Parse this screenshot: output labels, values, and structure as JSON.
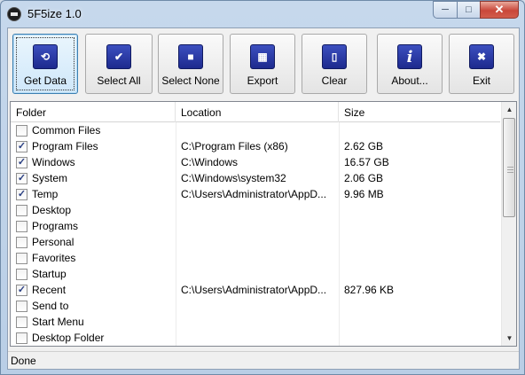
{
  "window": {
    "title": "5F5ize 1.0"
  },
  "toolbar": {
    "buttons": [
      {
        "label": "Get Data",
        "icon": "get-data-icon",
        "glyph": "⟲"
      },
      {
        "label": "Select All",
        "icon": "checkmark-icon",
        "glyph": "✔"
      },
      {
        "label": "Select None",
        "icon": "square-icon",
        "glyph": "■"
      },
      {
        "label": "Export",
        "icon": "export-icon",
        "glyph": "▦"
      },
      {
        "label": "Clear",
        "icon": "page-icon",
        "glyph": "▯"
      },
      {
        "label": "About...",
        "icon": "info-icon",
        "glyph": "i"
      },
      {
        "label": "Exit",
        "icon": "close-x-icon",
        "glyph": "✖"
      }
    ]
  },
  "list": {
    "columns": [
      "Folder",
      "Location",
      "Size"
    ],
    "rows": [
      {
        "checked": false,
        "folder": "Common Files",
        "location": "",
        "size": ""
      },
      {
        "checked": true,
        "folder": "Program Files",
        "location": "C:\\Program Files (x86)",
        "size": "2.62 GB"
      },
      {
        "checked": true,
        "folder": "Windows",
        "location": "C:\\Windows",
        "size": "16.57 GB"
      },
      {
        "checked": true,
        "folder": "System",
        "location": "C:\\Windows\\system32",
        "size": "2.06 GB"
      },
      {
        "checked": true,
        "folder": "Temp",
        "location": "C:\\Users\\Administrator\\AppD...",
        "size": "9.96 MB"
      },
      {
        "checked": false,
        "folder": "Desktop",
        "location": "",
        "size": ""
      },
      {
        "checked": false,
        "folder": "Programs",
        "location": "",
        "size": ""
      },
      {
        "checked": false,
        "folder": "Personal",
        "location": "",
        "size": ""
      },
      {
        "checked": false,
        "folder": "Favorites",
        "location": "",
        "size": ""
      },
      {
        "checked": false,
        "folder": "Startup",
        "location": "",
        "size": ""
      },
      {
        "checked": true,
        "folder": "Recent",
        "location": "C:\\Users\\Administrator\\AppD...",
        "size": "827.96 KB"
      },
      {
        "checked": false,
        "folder": "Send to",
        "location": "",
        "size": ""
      },
      {
        "checked": false,
        "folder": "Start Menu",
        "location": "",
        "size": ""
      },
      {
        "checked": false,
        "folder": "Desktop Folder",
        "location": "",
        "size": ""
      }
    ]
  },
  "status": {
    "text": "Done"
  }
}
